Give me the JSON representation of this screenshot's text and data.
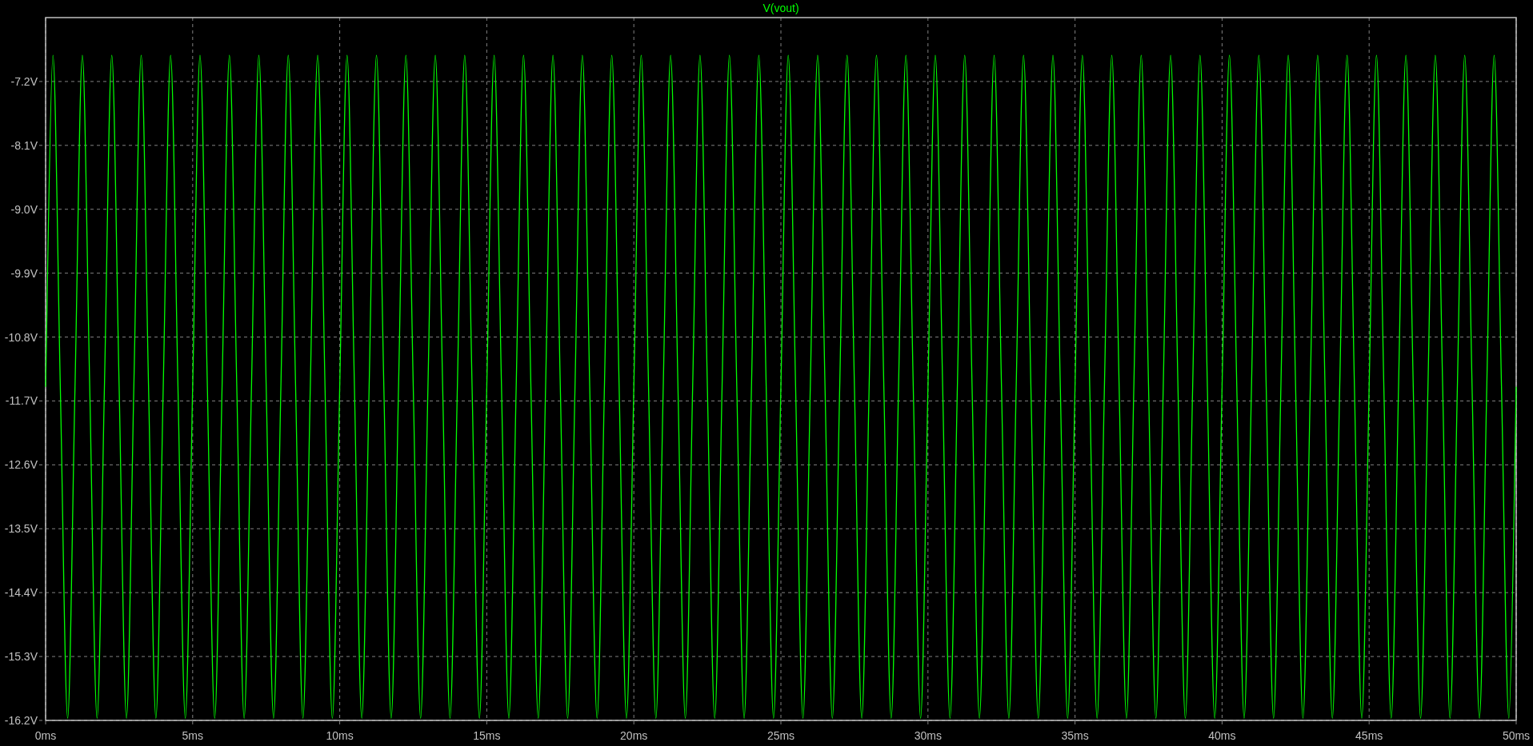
{
  "chart_data": {
    "type": "line",
    "grid": true,
    "xlim": [
      0,
      50
    ],
    "ylim": [
      -16.2,
      -6.3
    ],
    "xticks": [
      {
        "value": 0,
        "label": "0ms"
      },
      {
        "value": 5,
        "label": "5ms"
      },
      {
        "value": 10,
        "label": "10ms"
      },
      {
        "value": 15,
        "label": "15ms"
      },
      {
        "value": 20,
        "label": "20ms"
      },
      {
        "value": 25,
        "label": "25ms"
      },
      {
        "value": 30,
        "label": "30ms"
      },
      {
        "value": 35,
        "label": "35ms"
      },
      {
        "value": 40,
        "label": "40ms"
      },
      {
        "value": 45,
        "label": "45ms"
      },
      {
        "value": 50,
        "label": "50ms"
      }
    ],
    "yticks": [
      {
        "value": -7.2,
        "label": "-7.2V"
      },
      {
        "value": -8.1,
        "label": "-8.1V"
      },
      {
        "value": -9.0,
        "label": "-9.0V"
      },
      {
        "value": -9.9,
        "label": "-9.9V"
      },
      {
        "value": -10.8,
        "label": "-10.8V"
      },
      {
        "value": -11.7,
        "label": "-11.7V"
      },
      {
        "value": -12.6,
        "label": "-12.6V"
      },
      {
        "value": -13.5,
        "label": "-13.5V"
      },
      {
        "value": -14.4,
        "label": "-14.4V"
      },
      {
        "value": -15.3,
        "label": "-15.3V"
      },
      {
        "value": -16.2,
        "label": "-16.2V"
      }
    ],
    "x": [
      0,
      0.25,
      0.5,
      0.75,
      1,
      1.25,
      1.5,
      1.75,
      2,
      2.25,
      2.5,
      2.75,
      3,
      3.25,
      3.5,
      3.75,
      4,
      4.25,
      4.5,
      4.75,
      5,
      5.25,
      5.5,
      5.75,
      6,
      6.25,
      6.5,
      6.75,
      7,
      7.25,
      7.5,
      7.75,
      8,
      8.25,
      8.5,
      8.75,
      9,
      9.25,
      9.5,
      9.75,
      10,
      10.25,
      10.5,
      10.75,
      11,
      11.25,
      11.5,
      11.75,
      12,
      12.25,
      12.5,
      12.75,
      13,
      13.25,
      13.5,
      13.75,
      14,
      14.25,
      14.5,
      14.75,
      15,
      15.25,
      15.5,
      15.75,
      16,
      16.25,
      16.5,
      16.75,
      17,
      17.25,
      17.5,
      17.75,
      18,
      18.25,
      18.5,
      18.75,
      19,
      19.25,
      19.5,
      19.75,
      20,
      20.25,
      20.5,
      20.75,
      21,
      21.25,
      21.5,
      21.75,
      22,
      22.25,
      22.5,
      22.75,
      23,
      23.25,
      23.5,
      23.75,
      24,
      24.25,
      24.5,
      24.75,
      25,
      25.25,
      25.5,
      25.75,
      26,
      26.25,
      26.5,
      26.75,
      27,
      27.25,
      27.5,
      27.75,
      28,
      28.25,
      28.5,
      28.75,
      29,
      29.25,
      29.5,
      29.75,
      30,
      30.25,
      30.5,
      30.75,
      31,
      31.25,
      31.5,
      31.75,
      32,
      32.25,
      32.5,
      32.75,
      33,
      33.25,
      33.5,
      33.75,
      34,
      34.25,
      34.5,
      34.75,
      35,
      35.25,
      35.5,
      35.75,
      36,
      36.25,
      36.5,
      36.75,
      37,
      37.25,
      37.5,
      37.75,
      38,
      38.25,
      38.5,
      38.75,
      39,
      39.25,
      39.5,
      39.75,
      40,
      40.25,
      40.5,
      40.75,
      41,
      41.25,
      41.5,
      41.75,
      42,
      42.25,
      42.5,
      42.75,
      43,
      43.25,
      43.5,
      43.75,
      44,
      44.25,
      44.5,
      44.75,
      45,
      45.25,
      45.5,
      45.75,
      46,
      46.25,
      46.5,
      46.75,
      47,
      47.25,
      47.5,
      47.75,
      48,
      48.25,
      48.5,
      48.75,
      49,
      49.25,
      49.5,
      49.75,
      50
    ],
    "series": [
      {
        "name": "V(vout)",
        "color": "#00ff00",
        "values": [
          -11.5,
          -6.83,
          -11.5,
          -16.17,
          -11.5,
          -6.83,
          -11.5,
          -16.17,
          -11.5,
          -6.83,
          -11.5,
          -16.17,
          -11.5,
          -6.83,
          -11.5,
          -16.17,
          -11.5,
          -6.83,
          -11.5,
          -16.17,
          -11.5,
          -6.83,
          -11.5,
          -16.17,
          -11.5,
          -6.83,
          -11.5,
          -16.17,
          -11.5,
          -6.83,
          -11.5,
          -16.17,
          -11.5,
          -6.83,
          -11.5,
          -16.17,
          -11.5,
          -6.83,
          -11.5,
          -16.17,
          -11.5,
          -6.83,
          -11.5,
          -16.17,
          -11.5,
          -6.83,
          -11.5,
          -16.17,
          -11.5,
          -6.83,
          -11.5,
          -16.17,
          -11.5,
          -6.83,
          -11.5,
          -16.17,
          -11.5,
          -6.83,
          -11.5,
          -16.17,
          -11.5,
          -6.83,
          -11.5,
          -16.17,
          -11.5,
          -6.83,
          -11.5,
          -16.17,
          -11.5,
          -6.83,
          -11.5,
          -16.17,
          -11.5,
          -6.83,
          -11.5,
          -16.17,
          -11.5,
          -6.83,
          -11.5,
          -16.17,
          -11.5,
          -6.83,
          -11.5,
          -16.17,
          -11.5,
          -6.83,
          -11.5,
          -16.17,
          -11.5,
          -6.83,
          -11.5,
          -16.17,
          -11.5,
          -6.83,
          -11.5,
          -16.17,
          -11.5,
          -6.83,
          -11.5,
          -16.17,
          -11.5,
          -6.83,
          -11.5,
          -16.17,
          -11.5,
          -6.83,
          -11.5,
          -16.17,
          -11.5,
          -6.83,
          -11.5,
          -16.17,
          -11.5,
          -6.83,
          -11.5,
          -16.17,
          -11.5,
          -6.83,
          -11.5,
          -16.17,
          -11.5,
          -6.83,
          -11.5,
          -16.17,
          -11.5,
          -6.83,
          -11.5,
          -16.17,
          -11.5,
          -6.83,
          -11.5,
          -16.17,
          -11.5,
          -6.83,
          -11.5,
          -16.17,
          -11.5,
          -6.83,
          -11.5,
          -16.17,
          -11.5,
          -6.83,
          -11.5,
          -16.17,
          -11.5,
          -6.83,
          -11.5,
          -16.17,
          -11.5,
          -6.83,
          -11.5,
          -16.17,
          -11.5,
          -6.83,
          -11.5,
          -16.17,
          -11.5,
          -6.83,
          -11.5,
          -16.17,
          -11.5,
          -6.83,
          -11.5,
          -16.17,
          -11.5,
          -6.83,
          -11.5,
          -16.17,
          -11.5,
          -6.83,
          -11.5,
          -16.17,
          -11.5,
          -6.83,
          -11.5,
          -16.17,
          -11.5,
          -6.83,
          -11.5,
          -16.17,
          -11.5,
          -6.83,
          -11.5,
          -16.17,
          -11.5,
          -6.83,
          -11.5,
          -16.17,
          -11.5,
          -6.83,
          -11.5,
          -16.17,
          -11.5,
          -6.83,
          -11.5,
          -16.17,
          -11.5,
          -6.83,
          -11.5,
          -16.17,
          -11.5
        ]
      }
    ]
  }
}
